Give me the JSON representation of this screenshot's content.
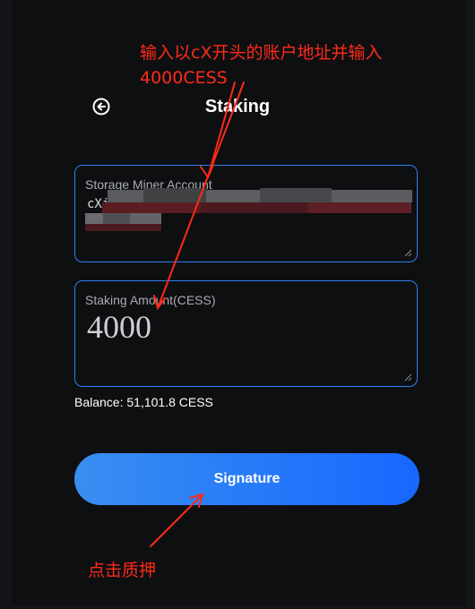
{
  "header": {
    "title": "Staking",
    "back_icon": "arrow-left-circle-icon"
  },
  "form": {
    "account": {
      "label": "Storage Miner Account",
      "value": "cXi"
    },
    "amount": {
      "label": "Staking Amount(CESS)",
      "value": "4000"
    },
    "balance": "Balance: 51,101.8 CESS",
    "submit_label": "Signature"
  },
  "annotations": {
    "top": "输入以cX开头的账户地址并输入4000CESS",
    "bottom": "点击质押"
  },
  "colors": {
    "accent": "#2f7df3",
    "button_gradient_start": "#3a8ef0",
    "button_gradient_end": "#1668ff",
    "annotation": "#ff2a1a",
    "background": "#0e0f11"
  }
}
